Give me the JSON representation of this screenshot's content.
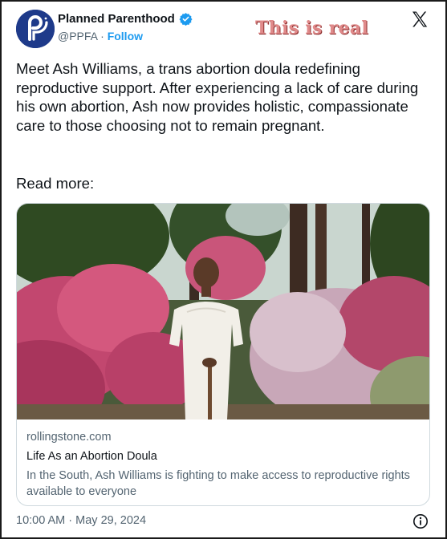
{
  "author": {
    "name": "Planned Parenthood",
    "handle": "@PPFA",
    "separator": "·",
    "follow_label": "Follow",
    "verified_icon": "verified-badge-icon",
    "avatar_icon": "planned-parenthood-logo"
  },
  "overlay_note": "This is real",
  "tweet": {
    "text": "Meet Ash Williams, a trans abortion doula redefining reproductive support. After experiencing a lack of care during his own abortion, Ash now provides holistic, compassionate care to those choosing not to remain pregnant.",
    "read_more": "Read more:"
  },
  "link_card": {
    "domain": "rollingstone.com",
    "title": "Life As an Abortion Doula",
    "description": "In the South, Ash Williams is fighting to make access to reproductive rights available to everyone"
  },
  "timestamp": "10:00 AM · May 29, 2024",
  "colors": {
    "accent": "#1d9bf0",
    "avatar_bg": "#1e3a8a",
    "overlay_text": "#e08a8a"
  }
}
